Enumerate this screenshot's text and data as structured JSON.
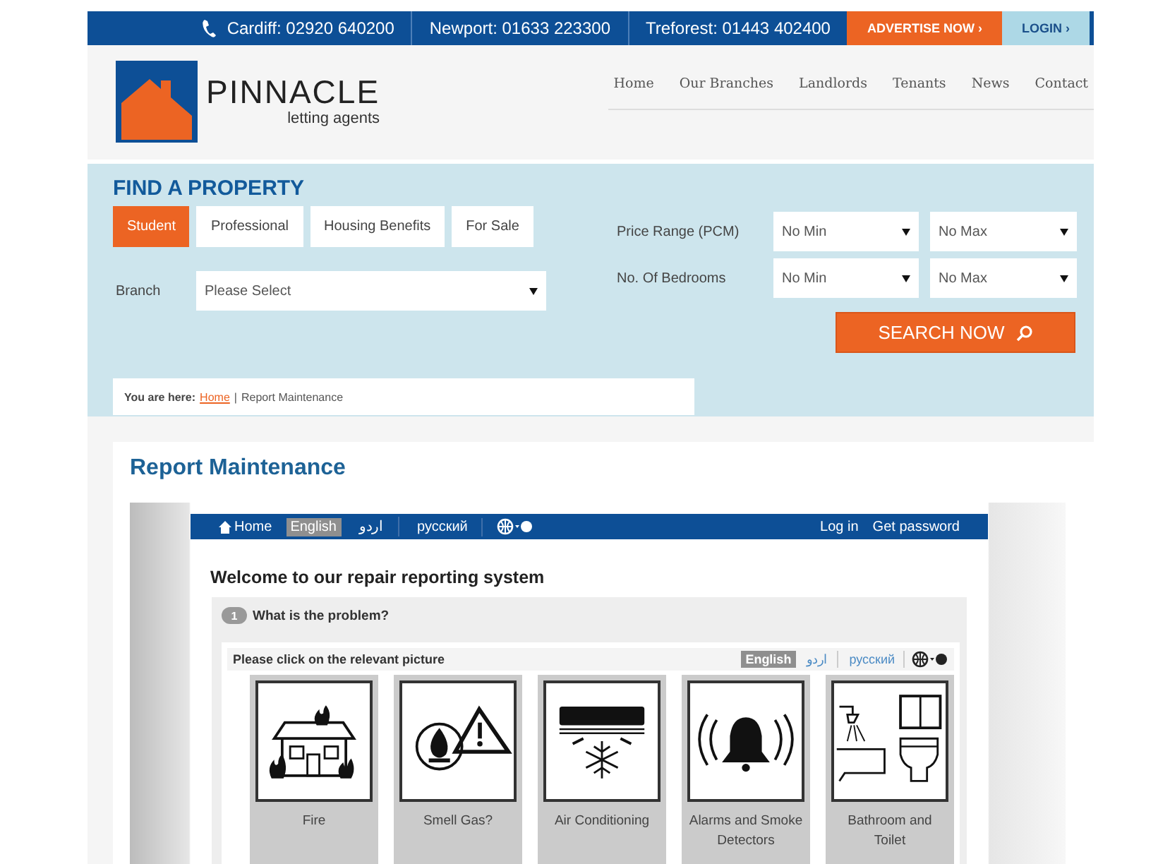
{
  "top_bar": {
    "contacts": [
      "Cardiff: 02920 640200",
      "Newport: 01633 223300",
      "Treforest: 01443 402400"
    ],
    "advertise": "ADVERTISE NOW ›",
    "login": "LOGIN ›"
  },
  "header": {
    "logo": {
      "name": "PINNACLE",
      "tagline": "letting agents"
    },
    "nav": [
      "Home",
      "Our Branches",
      "Landlords",
      "Tenants",
      "News",
      "Contact"
    ]
  },
  "search": {
    "title": "FIND A PROPERTY",
    "tabs": [
      {
        "label": "Student",
        "selected": true
      },
      {
        "label": "Professional",
        "selected": false
      },
      {
        "label": "Housing Benefits",
        "selected": false
      },
      {
        "label": "For Sale",
        "selected": false
      }
    ],
    "branch": {
      "label": "Branch",
      "value": "Please Select"
    },
    "filters": [
      {
        "label": "Price Range (PCM)",
        "min": "No Min",
        "max": "No Max"
      },
      {
        "label": "No. Of Bedrooms",
        "min": "No Min",
        "max": "No Max"
      }
    ],
    "search_button": "SEARCH NOW"
  },
  "breadcrumb": {
    "prefix": "You are here:",
    "link": "Home",
    "separator": "|",
    "current": "Report Maintenance"
  },
  "content": {
    "heading": "Report Maintenance",
    "portal": {
      "nav": {
        "home": "Home",
        "languages": [
          {
            "label": "English",
            "selected": true
          },
          {
            "label": "اردو",
            "selected": false
          },
          {
            "label": "русский",
            "selected": false
          }
        ],
        "login": "Log in",
        "password": "Get password"
      },
      "welcome": "Welcome to our repair reporting system",
      "step": {
        "number": "1",
        "question": "What is the problem?"
      },
      "instruction": "Please click on the relevant picture",
      "languages": [
        {
          "label": "English",
          "selected": true
        },
        {
          "label": "اردو",
          "selected": false
        },
        {
          "label": "русский",
          "selected": false
        }
      ],
      "categories": [
        {
          "kind": "fire",
          "label": "Fire"
        },
        {
          "kind": "gas",
          "label": "Smell Gas?"
        },
        {
          "kind": "air",
          "label": "Air Conditioning"
        },
        {
          "kind": "alarm",
          "label": "Alarms and Smoke Detectors"
        },
        {
          "kind": "bathroom",
          "label": "Bathroom and Toilet"
        }
      ]
    }
  }
}
